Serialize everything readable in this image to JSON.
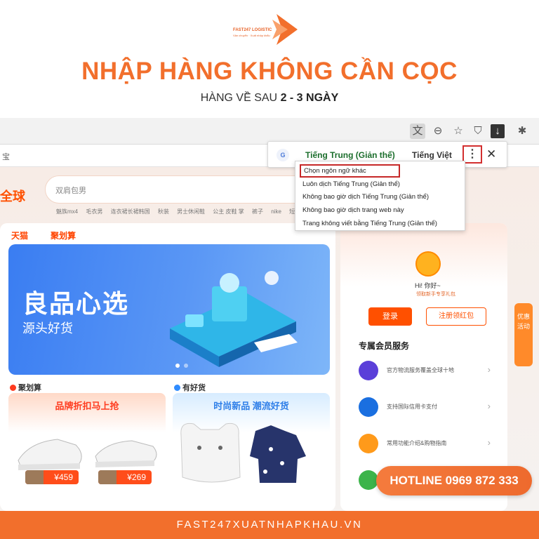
{
  "brand": {
    "name": "FAST247 LOGISTIC",
    "tagline": "Vận chuyển · Xuất nhập khẩu"
  },
  "header": {
    "headline": "NHẬP HÀNG KHÔNG CẦN CỌC",
    "sub_prefix": "HÀNG VỀ SAU ",
    "sub_bold": "2 - 3 NGÀY"
  },
  "browser": {
    "toolbar_icons": [
      "translate-icon",
      "zoom-out-icon",
      "star-icon",
      "shield-icon",
      "download-icon",
      "extensions-icon"
    ],
    "address_text": "宝"
  },
  "translate_popup": {
    "google_label": "G",
    "tab_source": "Tiếng Trung (Giản thể)",
    "tab_target": "Tiếng Việt",
    "menu_label": "⋮",
    "close_label": "✕",
    "menu_items": [
      "Chọn ngôn ngữ khác",
      "Luôn dịch Tiếng Trung (Giản thể)",
      "Không bao giờ dịch Tiếng Trung (Giản thể)",
      "Không bao giờ dịch trang web này",
      "Trang không viết bằng Tiếng Trung (Giản thể)"
    ]
  },
  "taobao": {
    "logo": "全球",
    "search_placeholder": "双肩包男",
    "hot_searches": [
      "魅族mx4",
      "毛衣男",
      "连衣裙长裙韩国",
      "秋装",
      "男士休闲鞋",
      "公主 皮鞋 掌",
      "裤子",
      "nike",
      "短"
    ],
    "nav_tabs": [
      "天猫",
      "聚划算"
    ],
    "hero_title": "良品心选",
    "hero_subtitle": "源头好货",
    "section_left": "聚划算",
    "section_right": "有好货",
    "promo_left_title": "品牌折扣马上抢",
    "promo_right_title": "时尚新品 潮流好货",
    "price_1": "¥459",
    "price_2": "¥269",
    "greeting": "Hi! 你好~",
    "greeting_sub": "领取新手专享礼包",
    "login_button": "登录",
    "register_button": "注册领红包",
    "member_title": "专属会员服务",
    "services": [
      {
        "text": "官方物流服务覆盖全球十地",
        "icon": "plane-icon",
        "color": "#5b3fd9"
      },
      {
        "text": "支持国际信用卡支付",
        "icon": "card-icon",
        "color": "#1a6fe0"
      },
      {
        "text": "常用功能介绍&购物指南",
        "icon": "compass-icon",
        "color": "#ff9a1a"
      },
      {
        "text": "",
        "icon": "shield-check-icon",
        "color": "#3cb44a"
      }
    ],
    "float_tab": "优惠 活动"
  },
  "hotline": "HOTLINE 0969 872 333",
  "footer": "FAST247XUATNHAPKHAU.VN",
  "colors": {
    "accent": "#f26f2c",
    "taobao_orange": "#ff5000",
    "highlight_red": "#c62828"
  }
}
